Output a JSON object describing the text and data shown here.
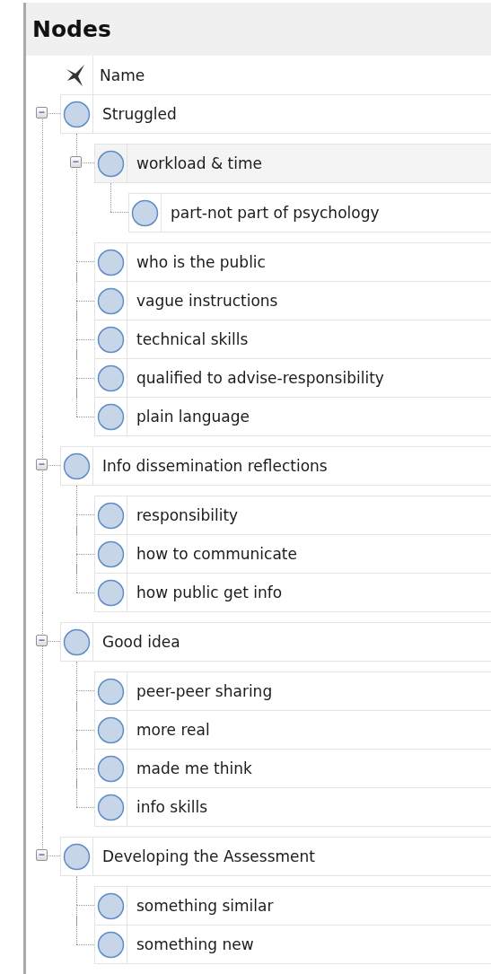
{
  "panel": {
    "title": "Nodes"
  },
  "name_column": {
    "label": "Name"
  },
  "nodes": [
    {
      "name": "Struggled",
      "expanded": true,
      "selected": false,
      "children": [
        {
          "name": "workload & time",
          "expanded": true,
          "selected": true,
          "children": [
            {
              "name": "part-not part of psychology",
              "selected": false
            }
          ]
        },
        {
          "name": "who is the public",
          "selected": false
        },
        {
          "name": "vague instructions",
          "selected": false
        },
        {
          "name": "technical skills",
          "selected": false
        },
        {
          "name": "qualified to advise-responsibility",
          "selected": false
        },
        {
          "name": "plain language",
          "selected": false
        }
      ]
    },
    {
      "name": "Info dissemination reflections",
      "expanded": true,
      "selected": false,
      "children": [
        {
          "name": "responsibility",
          "selected": false
        },
        {
          "name": "how to communicate",
          "selected": false
        },
        {
          "name": "how public get info",
          "selected": false
        }
      ]
    },
    {
      "name": "Good idea",
      "expanded": true,
      "selected": false,
      "children": [
        {
          "name": "peer-peer sharing",
          "selected": false
        },
        {
          "name": "more real",
          "selected": false
        },
        {
          "name": "made me think",
          "selected": false
        },
        {
          "name": "info skills",
          "selected": false
        }
      ]
    },
    {
      "name": "Developing the Assessment",
      "expanded": true,
      "selected": false,
      "children": [
        {
          "name": "something similar",
          "selected": false
        },
        {
          "name": "something new",
          "selected": false
        }
      ]
    }
  ]
}
